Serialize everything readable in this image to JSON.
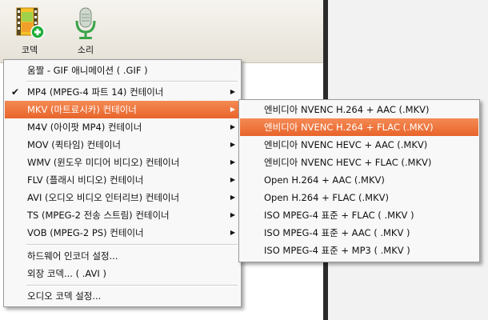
{
  "toolbar": {
    "codec_label": "코덱",
    "sound_label": "소리"
  },
  "colors": {
    "highlight": "#ee7036",
    "menu_bg": "#f8f8f8",
    "accent_green": "#1fae3a"
  },
  "main_menu": {
    "items": [
      {
        "label": "움짤 - GIF 애니메이션 ( .GIF )",
        "submenu": false,
        "checked": false
      },
      {
        "label": "MP4 (MPEG-4 파트 14) 컨테이너",
        "submenu": true,
        "checked": true
      },
      {
        "label": "MKV (마트료시카) 컨테이너",
        "submenu": true,
        "checked": false
      },
      {
        "label": "M4V (아이팟 MP4) 컨테이너",
        "submenu": true,
        "checked": false
      },
      {
        "label": "MOV (퀵타임) 컨테이너",
        "submenu": true,
        "checked": false
      },
      {
        "label": "WMV (윈도우 미디어 비디오) 컨테이너",
        "submenu": true,
        "checked": false
      },
      {
        "label": "FLV (플래시 비디오) 컨테이너",
        "submenu": true,
        "checked": false
      },
      {
        "label": "AVI (오디오 비디오 인터리브) 컨테이너",
        "submenu": true,
        "checked": false
      },
      {
        "label": "TS (MPEG-2 전송 스트림) 컨테이너",
        "submenu": true,
        "checked": false
      },
      {
        "label": "VOB (MPEG-2 PS) 컨테이너",
        "submenu": true,
        "checked": false
      },
      {
        "label": "하드웨어 인코더 설정...",
        "submenu": false,
        "checked": false
      },
      {
        "label": "외장 코덱... ( .AVI )",
        "submenu": false,
        "checked": false
      },
      {
        "label": "오디오 코덱 설정...",
        "submenu": false,
        "checked": false
      }
    ]
  },
  "sub_menu": {
    "items": [
      {
        "label": "엔비디아 NVENC H.264 + AAC (.MKV)"
      },
      {
        "label": "엔비디아 NVENC H.264 + FLAC (.MKV)"
      },
      {
        "label": "엔비디아 NVENC HEVC + AAC (.MKV)"
      },
      {
        "label": "엔비디아 NVENC HEVC + FLAC (.MKV)"
      },
      {
        "label": "Open H.264 + AAC (.MKV)"
      },
      {
        "label": "Open H.264 + FLAC (.MKV)"
      },
      {
        "label": "ISO MPEG-4 표준 + FLAC ( .MKV )"
      },
      {
        "label": "ISO MPEG-4 표준 + AAC ( .MKV )"
      },
      {
        "label": "ISO MPEG-4 표준 + MP3 ( .MKV )"
      }
    ]
  }
}
